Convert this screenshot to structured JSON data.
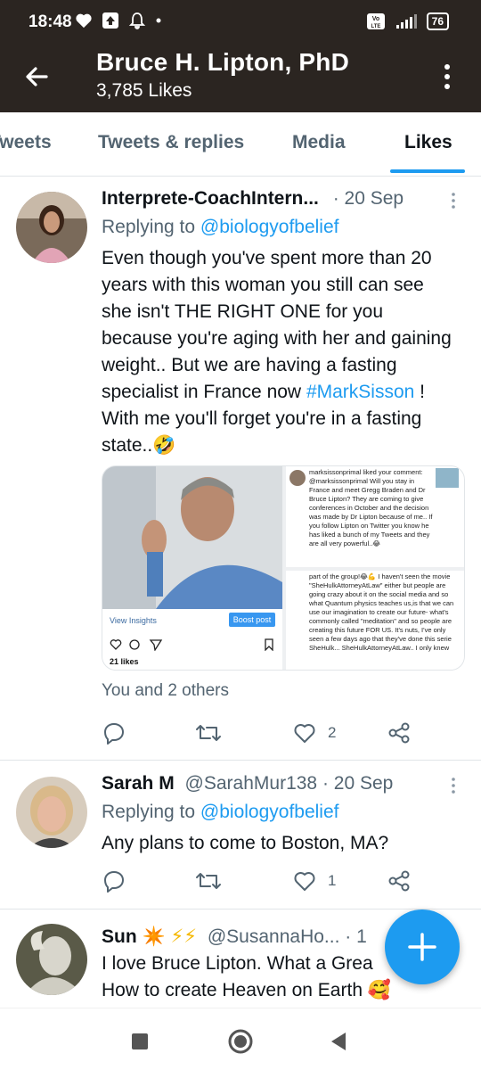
{
  "status_bar": {
    "time": "18:48",
    "battery": "76"
  },
  "header": {
    "title": "Bruce H. Lipton, PhD",
    "subtitle": "3,785 Likes"
  },
  "tabs": [
    {
      "label": "Tweets"
    },
    {
      "label": "Tweets & replies"
    },
    {
      "label": "Media"
    },
    {
      "label": "Likes",
      "active": true
    }
  ],
  "tweets": [
    {
      "name": "Interprete-CoachIntern...",
      "handle": "",
      "date": "· 20 Sep",
      "reply_prefix": "Replying to ",
      "reply_to": "@biologyofbelief",
      "body_before": "Even though you've spent more than 20 years with this woman you still can see she isn't THE RIGHT ONE for you because you're aging with her and gaining weight.. But we are having a fasting specialist in France now ",
      "hashtag": "#MarkSisson",
      "body_after": " ! With me you'll forget you're in a fasting state..🤣",
      "media": {
        "left": {
          "view_insights": "View Insights",
          "boost_post": "Boost post",
          "likes": "21 likes"
        },
        "right_top": "marksissonprimal liked your comment: @marksissonprimal Will you stay in France and meet Gregg Braden and Dr Bruce Lipton? They are coming to give conferences in October and the decision was made by Dr Lipton because of me.. If you follow Lipton on Twitter you know he has liked a bunch of my Tweets and they are all very powerful..😂",
        "right_bottom": "part of the group!😂💪 I haven't seen the movie \"SheHulkAttorneyAtLaw\" either but people are going crazy about it on the social media and so what Quantum physics teaches us,is that we can use our imagination to create our future- what's commonly called \"meditation\" and so people are creating this future FOR US. It's nuts, I've only seen a few days ago that they've done this serie SheHulk... SheHulkAttorneyAtLaw.. I only knew"
      },
      "liked_by": "You and 2 others",
      "likes": "2"
    },
    {
      "name": "Sarah M",
      "handle": "@SarahMur138",
      "date": "· 20 Sep",
      "reply_prefix": "Replying to ",
      "reply_to": "@biologyofbelief",
      "body": "Any plans to come to Boston, MA?",
      "likes": "1"
    },
    {
      "name": "Sun",
      "emojis": "✴️ ⚡⚡",
      "handle": "@SusannaHo...",
      "date": "· 1",
      "body_line1": "I love Bruce Lipton. What a Grea",
      "body_line2": "How to create Heaven on Earth 🥰"
    }
  ],
  "colors": {
    "accent": "#1d9bf0",
    "header_bg": "#2b2521",
    "muted": "#536471"
  }
}
